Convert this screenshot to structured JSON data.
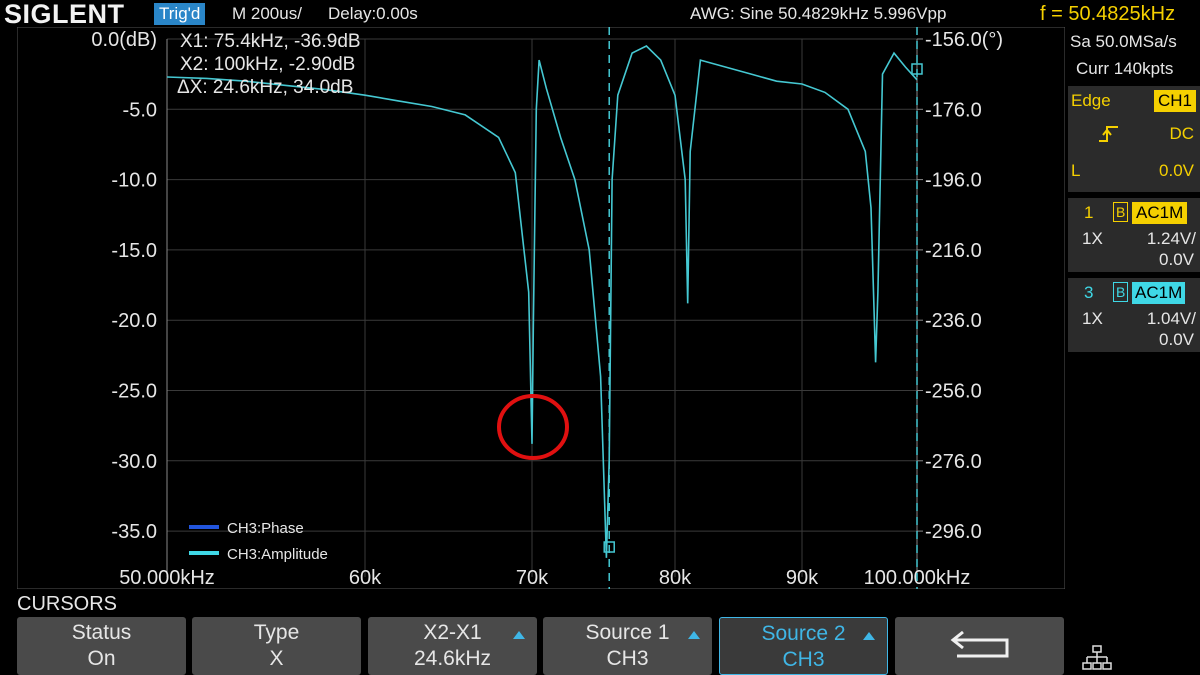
{
  "header": {
    "brand": "SIGLENT",
    "trigger_status": "Trig'd",
    "timebase": "M 200us/",
    "delay": "Delay:0.00s",
    "awg": "AWG: Sine  50.4829kHz  5.996Vpp",
    "frequency": "f = 50.4825kHz"
  },
  "plot": {
    "left_axis_labels": [
      "0.0(dB)",
      "-5.0",
      "-10.0",
      "-15.0",
      "-20.0",
      "-25.0",
      "-30.0",
      "-35.0"
    ],
    "right_axis_labels": [
      "-156.0(°)",
      "-176.0",
      "-196.0",
      "-216.0",
      "-236.0",
      "-256.0",
      "-276.0",
      "-296.0"
    ],
    "x_axis_labels": [
      "50.000kHz",
      "60k",
      "70k",
      "80k",
      "90k",
      "100.000kHz"
    ],
    "cursor_readout": {
      "x1": "X1: 75.4kHz, -36.9dB",
      "x2": "X2: 100kHz, -2.90dB",
      "dx": "ΔX: 24.6kHz, 34.0dB"
    },
    "legend": [
      {
        "label": "CH3:Phase",
        "color": "#2255dd"
      },
      {
        "label": "CH3:Amplitude",
        "color": "#3fd8e6"
      }
    ],
    "trace_color": "#45c8d2",
    "annotation_color": "#e01010"
  },
  "chart_data": {
    "type": "line",
    "x_unit": "kHz",
    "y_unit": "dB",
    "xlim": [
      50,
      100
    ],
    "ylim": [
      -38,
      0
    ],
    "y2lim": [
      -300,
      -156
    ],
    "series": [
      {
        "name": "CH3:Amplitude",
        "x": [
          50,
          52,
          54,
          56,
          58,
          60,
          62,
          64,
          66,
          68,
          69,
          69.8,
          70.0,
          70.1,
          70.3,
          70.5,
          71,
          72,
          73,
          74,
          74.8,
          75.2,
          75.4,
          75.6,
          76,
          77,
          78,
          79,
          80,
          80.8,
          81.0,
          81.2,
          82,
          84,
          86,
          88,
          90,
          92,
          94,
          95.5,
          96,
          96.4,
          96.6,
          97,
          98,
          99,
          100
        ],
        "values": [
          -2.7,
          -2.8,
          -3.0,
          -3.3,
          -3.6,
          -4.0,
          -4.4,
          -4.8,
          -5.4,
          -7.0,
          -9.5,
          -18,
          -28.8,
          -20,
          -5,
          -1.5,
          -3.5,
          -7,
          -10,
          -15,
          -24,
          -36.9,
          -30,
          -10,
          -4,
          -1.0,
          -0.5,
          -1.5,
          -4,
          -10,
          -18.8,
          -8,
          -1.5,
          -2.0,
          -2.5,
          -3.0,
          -3.2,
          -3.8,
          -5.0,
          -8,
          -12,
          -23,
          -18,
          -2.5,
          -1.0,
          -2.0,
          -2.9
        ]
      }
    ],
    "cursors": [
      75.4,
      100
    ]
  },
  "right_panel": {
    "sample_rate": "Sa 50.0MSa/s",
    "memory": "Curr 140kpts",
    "trigger": {
      "mode": "Edge",
      "source": "CH1",
      "coupling": "DC",
      "level_label": "L",
      "level": "0.0V"
    },
    "channels": [
      {
        "number": "1",
        "bw_flag": "B",
        "coupling": "AC1M",
        "probe": "1X",
        "scale": "1.24V/",
        "offset": "0.0V"
      },
      {
        "number": "3",
        "bw_flag": "B",
        "coupling": "AC1M",
        "probe": "1X",
        "scale": "1.04V/",
        "offset": "0.0V"
      }
    ]
  },
  "menu": {
    "title": "CURSORS",
    "softkeys": [
      {
        "line1": "Status",
        "line2": "On"
      },
      {
        "line1": "Type",
        "line2": "X"
      },
      {
        "line1": "X2-X1",
        "line2": "24.6kHz"
      },
      {
        "line1": "Source 1",
        "line2": "CH3"
      },
      {
        "line1": "Source 2",
        "line2": "CH3"
      }
    ],
    "back_icon": "return-arrow-icon",
    "network_icon": "network-icon"
  }
}
